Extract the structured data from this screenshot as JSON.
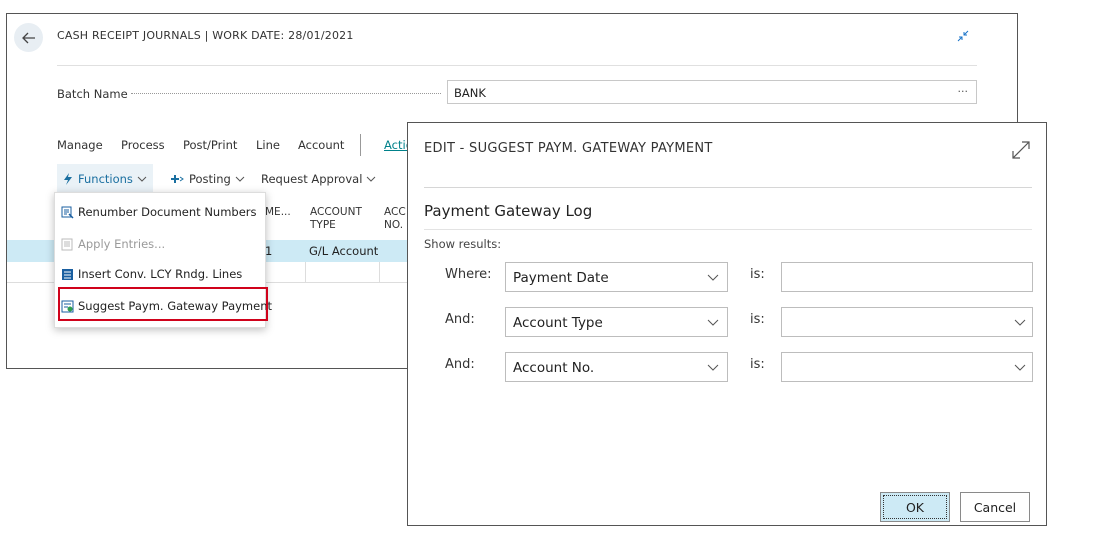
{
  "page": {
    "title": "CASH RECEIPT JOURNALS | WORK DATE: 28/01/2021",
    "batch_name_label": "Batch Name",
    "batch_name_value": "BANK",
    "batch_ellipsis": "···"
  },
  "action_bar": {
    "items": [
      "Manage",
      "Process",
      "Post/Print",
      "Line",
      "Account"
    ],
    "actions_link": "Actio"
  },
  "sub_bar": {
    "functions": "Functions",
    "posting": "Posting",
    "request_approval": "Request Approval"
  },
  "grid": {
    "col_name_partial": "ME...",
    "col_account_type": [
      "ACCOUNT",
      "TYPE"
    ],
    "col_account_no": [
      "ACC",
      "NO."
    ],
    "row1": {
      "name_partial": "1",
      "account_type": "G/L Account"
    }
  },
  "menu": {
    "items": [
      {
        "label": "Renumber Document Numbers",
        "icon": "renumber-icon",
        "enabled": true
      },
      {
        "label": "Apply Entries...",
        "icon": "apply-entries-icon",
        "enabled": false
      },
      {
        "label": "Insert Conv. LCY Rndg. Lines",
        "icon": "insert-lines-icon",
        "enabled": true
      },
      {
        "label": "Suggest Paym. Gateway Payment",
        "icon": "suggest-payment-icon",
        "enabled": true,
        "highlighted": true
      }
    ]
  },
  "dialog": {
    "title": "EDIT - SUGGEST PAYM. GATEWAY PAYMENT",
    "section_title": "Payment Gateway Log",
    "show_results": "Show results:",
    "filters": [
      {
        "connector": "Where:",
        "field": "Payment Date",
        "is": "is:",
        "value": "",
        "value_has_dropdown": false
      },
      {
        "connector": "And:",
        "field": "Account Type",
        "is": "is:",
        "value": "",
        "value_has_dropdown": true
      },
      {
        "connector": "And:",
        "field": "Account No.",
        "is": "is:",
        "value": "",
        "value_has_dropdown": true
      }
    ],
    "ok": "OK",
    "cancel": "Cancel"
  },
  "colors": {
    "accent": "#00818a",
    "selected_row": "#cdeaf5",
    "highlight_border": "#d0021b"
  }
}
